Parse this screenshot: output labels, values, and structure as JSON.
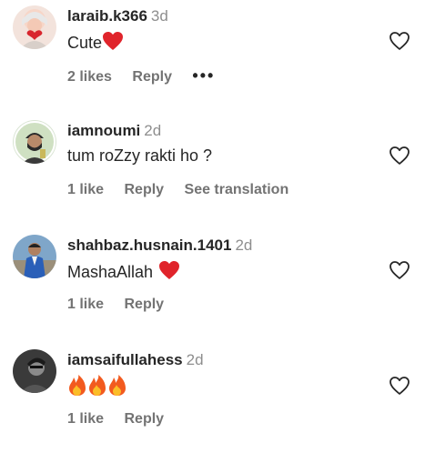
{
  "comments": [
    {
      "username": "laraib.k366",
      "time": "3d",
      "text": "Cute",
      "emoji": [
        "red-heart"
      ],
      "likes": "2 likes",
      "reply": "Reply",
      "more": "•••"
    },
    {
      "username": "iamnoumi",
      "time": "2d",
      "text": "tum roZzy rakti ho ?",
      "emoji": [],
      "likes": "1 like",
      "reply": "Reply",
      "see_translation": "See translation"
    },
    {
      "username": "shahbaz.husnain.1401",
      "time": "2d",
      "text": "MashaAllah",
      "emoji": [
        "red-heart"
      ],
      "likes": "1 like",
      "reply": "Reply"
    },
    {
      "username": "iamsaifullahess",
      "time": "2d",
      "text": "",
      "emoji": [
        "fire",
        "fire",
        "fire"
      ],
      "likes": "1 like",
      "reply": "Reply"
    }
  ],
  "colors": {
    "text": "#262626",
    "secondary": "#737373",
    "heart_red": "#e0242b"
  }
}
